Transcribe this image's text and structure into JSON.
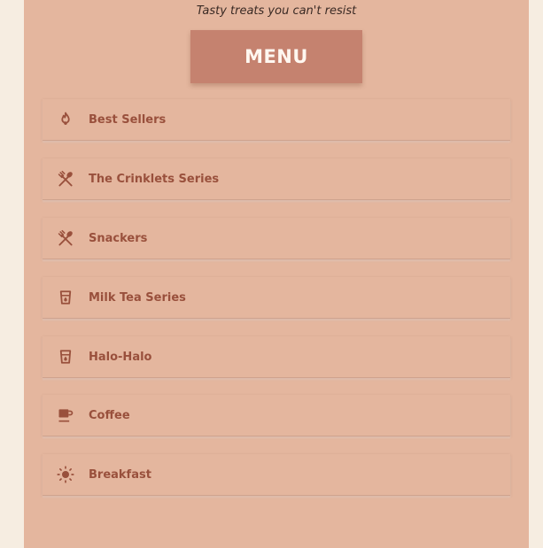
{
  "header": {
    "tagline": "Tasty treats you can't resist",
    "menu_label": "MENU"
  },
  "colors": {
    "background": "#f6ede1",
    "panel": "#e4b69e",
    "menu_button": "#c5826f",
    "item_text": "#99503c"
  },
  "menu": {
    "items": [
      {
        "label": "Best Sellers",
        "icon": "fire-icon"
      },
      {
        "label": "The Crinklets Series",
        "icon": "utensils-icon"
      },
      {
        "label": "Snackers",
        "icon": "utensils-icon"
      },
      {
        "label": "Milk Tea Series",
        "icon": "cup-icon"
      },
      {
        "label": "Halo-Halo",
        "icon": "cup-icon"
      },
      {
        "label": "Coffee",
        "icon": "coffee-mug-icon"
      },
      {
        "label": "Breakfast",
        "icon": "sun-icon"
      }
    ]
  }
}
